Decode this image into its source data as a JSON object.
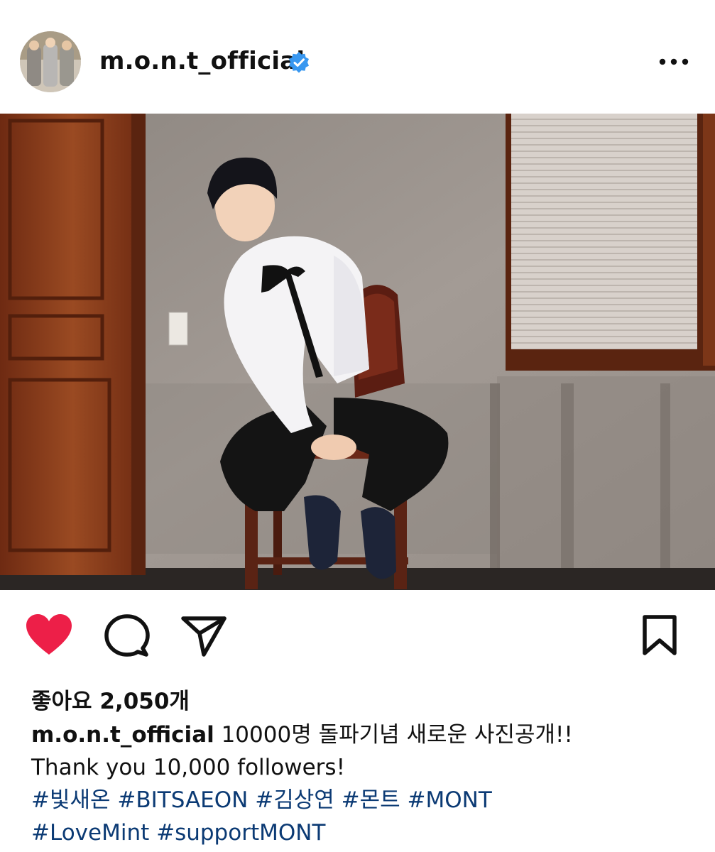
{
  "post": {
    "username": "m.o.n.t_official",
    "verified_icon": "verified-badge-icon",
    "more_icon": "more-options-icon",
    "accent_color": "#3897f0",
    "like_color": "#ed1f48",
    "hashtag_color": "#0b3a74"
  },
  "actions": {
    "like_icon": "heart-icon",
    "comment_icon": "comment-icon",
    "share_icon": "share-icon",
    "save_icon": "bookmark-icon",
    "liked": true
  },
  "likes": {
    "label": "좋아요 2,050개"
  },
  "caption": {
    "username": "m.o.n.t_official",
    "line1": " 10000명 돌파기념 새로운 사진공개!!",
    "line2": "Thank you 10,000 followers!",
    "hashtags_row1": [
      "#빛새온",
      "#BITSAEON",
      "#김상연",
      "#몬트",
      "#MONT"
    ],
    "hashtags_row2": [
      "#LoveMint",
      "#supportMONT"
    ]
  }
}
